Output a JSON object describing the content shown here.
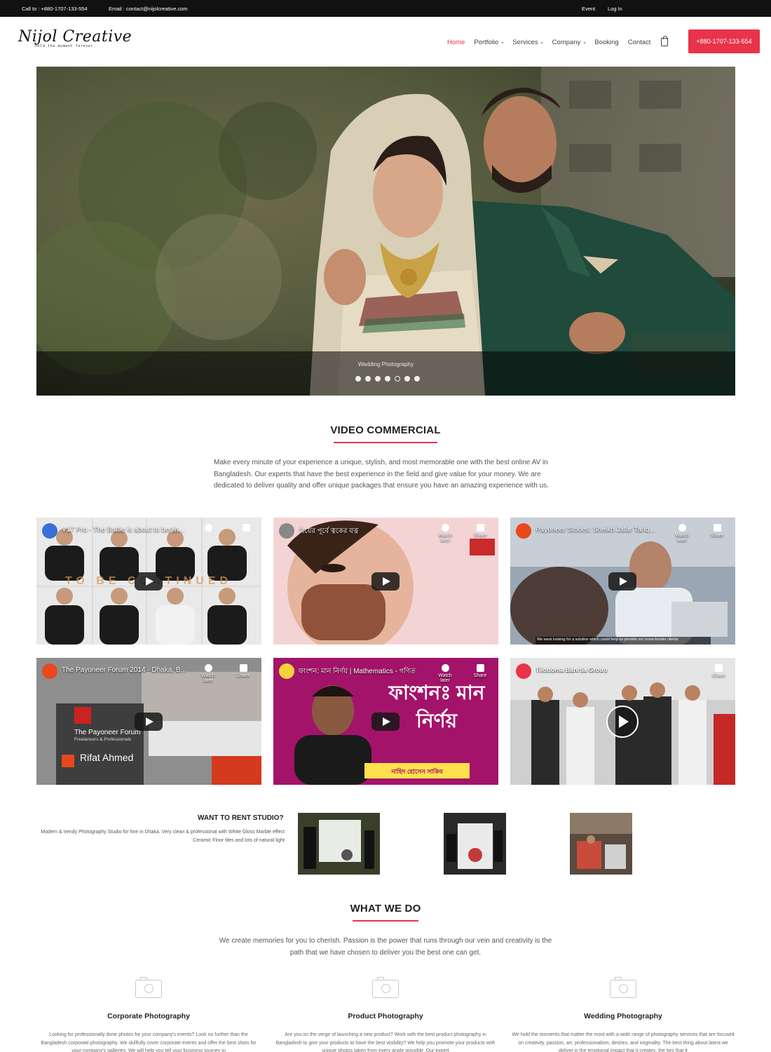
{
  "topbar": {
    "call": "Call to : +880-1707-133-554",
    "email": "Email : contact@nijolcreative.com",
    "event": "Event",
    "login": "Log In"
  },
  "brand": {
    "name": "Nijol Creative",
    "tagline": "hold the moment forever"
  },
  "nav": {
    "items": [
      "Home",
      "Portfolio",
      "Services",
      "Company",
      "Booking",
      "Contact"
    ],
    "cta": "+880-1707-133-554"
  },
  "hero": {
    "caption": "Wedding Photography",
    "slide_count": 7,
    "active_slide": 5
  },
  "video_commercial": {
    "title": "VIDEO COMMERCIAL",
    "intro": "Make every minute of your experience a unique, stylish, and most memorable one with the best online AV in Bangladesh. Our experts that have the best experience in the field and give value for your money. We are dedicated to deliver quality and offer unique packages that ensure you have an amazing experience with us.",
    "videos": [
      {
        "title": "V17 Pro - The Battle is about to begin...",
        "overlay": "TO BE CONTINUED",
        "watch_later": "",
        "share": ""
      },
      {
        "title": "বিয়ের পূর্বে ত্বকের যত্ন",
        "watch_later": "Watch later",
        "share": "Share"
      },
      {
        "title": "Payoneer Stories: Sheikh Jafar Tariq...",
        "watch_later": "Watch later",
        "share": "Share",
        "subtitle": "We were looking for a solution which could help us provide our cross-border clients"
      },
      {
        "title": "The Payoneer Forum 2014 - Dhaka, B...",
        "watch_later": "Watch later",
        "share": "Share",
        "screen_text": "The Payoneer Forum",
        "screen_sub": "Freelancers & Professionals",
        "name_text": "Rifat Ahmed"
      },
      {
        "title": "ফাংশন: মান নির্ণয় | Mathematics - গণিত",
        "watch_later": "Watch later",
        "share": "Share",
        "big_text": "ফাংশনঃ মান নির্ণয়",
        "banner": "নাহিদ হোসেন সাকিব"
      },
      {
        "title": "Tilottoma Bangla Group",
        "share": "Share"
      }
    ]
  },
  "rent": {
    "title": "WANT TO RENT STUDIO?",
    "description": "Modern & trendy Photography Studio for hire in Dhaka. Very clean & professional with White Gloss Marble effect Ceramic Floor tiles and lots of natural light"
  },
  "what_we_do": {
    "title": "WHAT WE DO",
    "intro": "We create memories for you to cherish. Passion is the power that runs through our vein and creativity is the path that we have chosen to deliver you the best one can get.",
    "services": [
      {
        "title": "Corporate Photography",
        "text": "Looking for professionally done photos for your company's events? Look no further than the Bangladesh corporate photography. We skillfully cover corporate events and offer the best shots for your company's galleries. We will help you tell your business journey in"
      },
      {
        "title": "Product Photography",
        "text": "Are you on the verge of launching a new product? Work with the best product photography in Bangladesh to give your products to have the best visibility? We help you promote your products with unique photos taken from every angle possible. Our expert"
      },
      {
        "title": "Wedding Photography",
        "text": "We hold the moments that matter the most with a wide range of photography services that are focused on creativity, passion, art, professionalism, desires, and originality. The best thing about latest we deliver is the emotional impact that it creates, the ties that it"
      }
    ]
  },
  "colors": {
    "accent": "#e8334a",
    "topbar": "#111111"
  },
  "icons": [
    "shopping-bag-icon",
    "camera-icon",
    "play-icon",
    "clock-icon",
    "share-icon"
  ]
}
